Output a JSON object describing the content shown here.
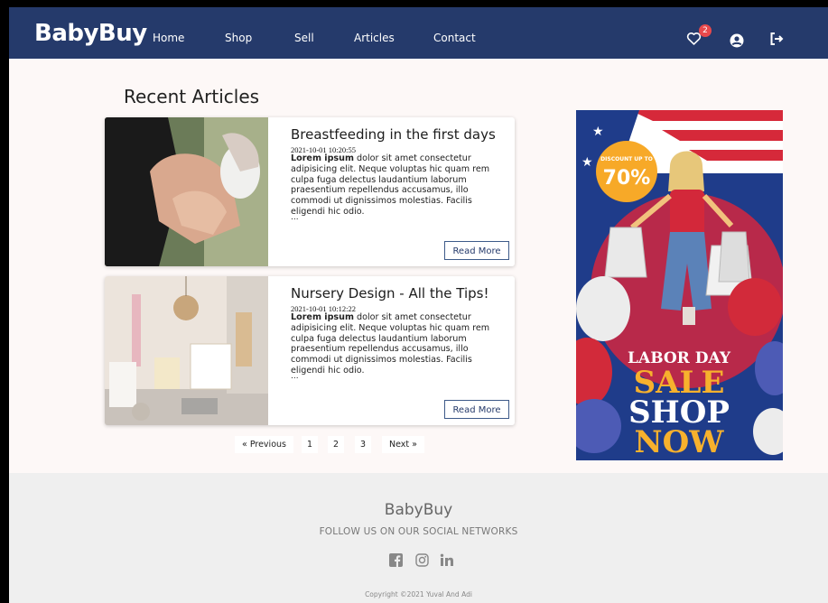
{
  "header": {
    "brand": "BabyBuy",
    "nav": [
      "Home",
      "Shop",
      "Sell",
      "Articles",
      "Contact"
    ],
    "wishlist_count": "2",
    "icons": [
      "heart-icon",
      "user-icon",
      "logout-icon"
    ]
  },
  "main": {
    "title": "Recent Articles",
    "articles": [
      {
        "title": "Breastfeeding in the first days",
        "date": "2021-10-01 10:20:55",
        "lead": "Lorem ipsum",
        "body": " dolor sit amet consectetur adipisicing elit. Neque voluptas hic quam rem culpa fuga delectus laudantium laborum praesentium repellendus accusamus, illo commodi ut dignissimos molestias. Facilis eligendi hic odio.",
        "ellipsis": "...",
        "button": "Read More"
      },
      {
        "title": "Nursery Design - All the Tips!",
        "date": "2021-10-01 10:12:22",
        "lead": "Lorem ipsum",
        "body": " dolor sit amet consectetur adipisicing elit. Neque voluptas hic quam rem culpa fuga delectus laudantium laborum praesentium repellendus accusamus, illo commodi ut dignissimos molestias. Facilis eligendi hic odio.",
        "ellipsis": "...",
        "button": "Read More"
      }
    ],
    "pagination": {
      "prev": "« Previous",
      "pages": [
        "1",
        "2",
        "3"
      ],
      "next": "Next »"
    }
  },
  "ad": {
    "discount_label": "DISCOUNT UP TO",
    "discount": "70%",
    "line1": "LABOR DAY",
    "line2": "SALE",
    "line3": "SHOP",
    "line4": "NOW"
  },
  "footer": {
    "brand": "BabyBuy",
    "follow": "FOLLOW US ON OUR SOCIAL NETWORKS",
    "social": [
      "facebook-icon",
      "instagram-icon",
      "linkedin-icon"
    ],
    "copyright": "Copyright ©2021 Yuval And Adi"
  },
  "colors": {
    "navbar": "#253a6b",
    "page_bg": "#fdf8f7",
    "footer_bg": "#efefef",
    "badge": "#e8494c"
  }
}
